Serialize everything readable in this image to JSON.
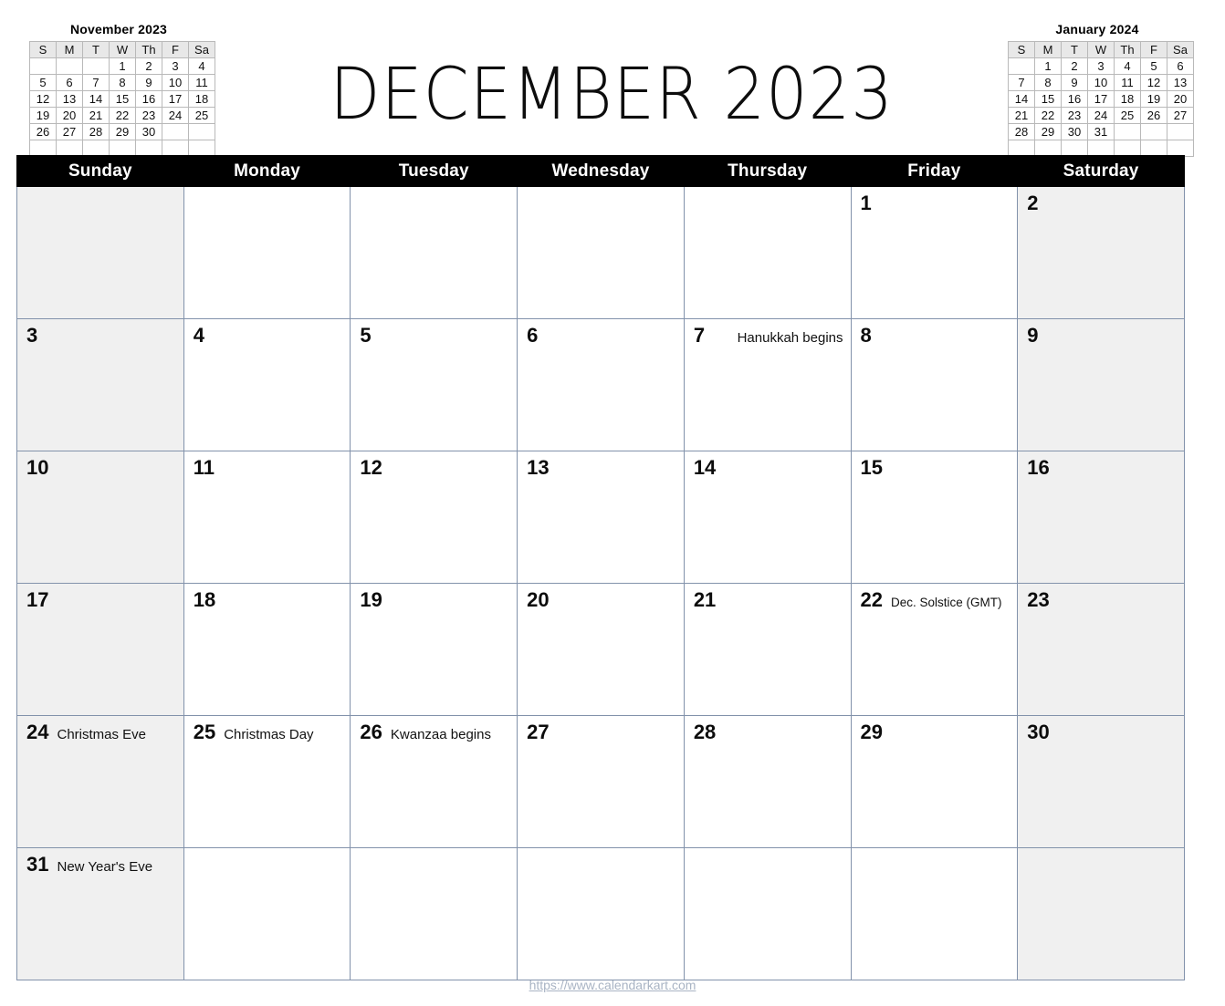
{
  "title": "DECEMBER  2023",
  "mini_calendars": [
    {
      "name": "november-2023",
      "title": "November 2023",
      "weekday_headers": [
        "S",
        "M",
        "T",
        "W",
        "Th",
        "F",
        "Sa"
      ],
      "weeks": [
        [
          "",
          "",
          "",
          "1",
          "2",
          "3",
          "4"
        ],
        [
          "5",
          "6",
          "7",
          "8",
          "9",
          "10",
          "11"
        ],
        [
          "12",
          "13",
          "14",
          "15",
          "16",
          "17",
          "18"
        ],
        [
          "19",
          "20",
          "21",
          "22",
          "23",
          "24",
          "25"
        ],
        [
          "26",
          "27",
          "28",
          "29",
          "30",
          "",
          ""
        ],
        [
          "",
          "",
          "",
          "",
          "",
          "",
          ""
        ]
      ]
    },
    {
      "name": "january-2024",
      "title": "January 2024",
      "weekday_headers": [
        "S",
        "M",
        "T",
        "W",
        "Th",
        "F",
        "Sa"
      ],
      "weeks": [
        [
          "",
          "1",
          "2",
          "3",
          "4",
          "5",
          "6"
        ],
        [
          "7",
          "8",
          "9",
          "10",
          "11",
          "12",
          "13"
        ],
        [
          "14",
          "15",
          "16",
          "17",
          "18",
          "19",
          "20"
        ],
        [
          "21",
          "22",
          "23",
          "24",
          "25",
          "26",
          "27"
        ],
        [
          "28",
          "29",
          "30",
          "31",
          "",
          "",
          ""
        ],
        [
          "",
          "",
          "",
          "",
          "",
          "",
          ""
        ]
      ]
    }
  ],
  "weekday_headers": [
    "Sunday",
    "Monday",
    "Tuesday",
    "Wednesday",
    "Thursday",
    "Friday",
    "Saturday"
  ],
  "weeks": [
    [
      {
        "day": "",
        "event": "",
        "shaded": true
      },
      {
        "day": "",
        "event": "",
        "shaded": false
      },
      {
        "day": "",
        "event": "",
        "shaded": false
      },
      {
        "day": "",
        "event": "",
        "shaded": false
      },
      {
        "day": "",
        "event": "",
        "shaded": false
      },
      {
        "day": "1",
        "event": "",
        "shaded": false
      },
      {
        "day": "2",
        "event": "",
        "shaded": true
      }
    ],
    [
      {
        "day": "3",
        "event": "",
        "shaded": true
      },
      {
        "day": "4",
        "event": "",
        "shaded": false
      },
      {
        "day": "5",
        "event": "",
        "shaded": false
      },
      {
        "day": "6",
        "event": "",
        "shaded": false
      },
      {
        "day": "7",
        "event": "Hanukkah begins",
        "shaded": false,
        "align": "right"
      },
      {
        "day": "8",
        "event": "",
        "shaded": false
      },
      {
        "day": "9",
        "event": "",
        "shaded": true
      }
    ],
    [
      {
        "day": "10",
        "event": "",
        "shaded": true
      },
      {
        "day": "11",
        "event": "",
        "shaded": false
      },
      {
        "day": "12",
        "event": "",
        "shaded": false
      },
      {
        "day": "13",
        "event": "",
        "shaded": false
      },
      {
        "day": "14",
        "event": "",
        "shaded": false
      },
      {
        "day": "15",
        "event": "",
        "shaded": false
      },
      {
        "day": "16",
        "event": "",
        "shaded": true
      }
    ],
    [
      {
        "day": "17",
        "event": "",
        "shaded": true
      },
      {
        "day": "18",
        "event": "",
        "shaded": false
      },
      {
        "day": "19",
        "event": "",
        "shaded": false
      },
      {
        "day": "20",
        "event": "",
        "shaded": false
      },
      {
        "day": "21",
        "event": "",
        "shaded": false
      },
      {
        "day": "22",
        "event": "Dec. Solstice (GMT)",
        "shaded": false,
        "small": true
      },
      {
        "day": "23",
        "event": "",
        "shaded": true
      }
    ],
    [
      {
        "day": "24",
        "event": "Christmas Eve",
        "shaded": true
      },
      {
        "day": "25",
        "event": "Christmas Day",
        "shaded": false
      },
      {
        "day": "26",
        "event": "Kwanzaa begins",
        "shaded": false
      },
      {
        "day": "27",
        "event": "",
        "shaded": false
      },
      {
        "day": "28",
        "event": "",
        "shaded": false
      },
      {
        "day": "29",
        "event": "",
        "shaded": false
      },
      {
        "day": "30",
        "event": "",
        "shaded": true
      }
    ],
    [
      {
        "day": "31",
        "event": "New Year's Eve",
        "shaded": true
      },
      {
        "day": "",
        "event": "",
        "shaded": false
      },
      {
        "day": "",
        "event": "",
        "shaded": false
      },
      {
        "day": "",
        "event": "",
        "shaded": false
      },
      {
        "day": "",
        "event": "",
        "shaded": false
      },
      {
        "day": "",
        "event": "",
        "shaded": false
      },
      {
        "day": "",
        "event": "",
        "shaded": true
      }
    ]
  ],
  "footer": {
    "url": "https://www.calendarkart.com"
  },
  "colors": {
    "header_bg": "#000000",
    "header_text": "#ffffff",
    "grid_line": "#8292ab",
    "weekend_shade": "#f0f0f0",
    "footer_text": "#a9b4c4"
  }
}
